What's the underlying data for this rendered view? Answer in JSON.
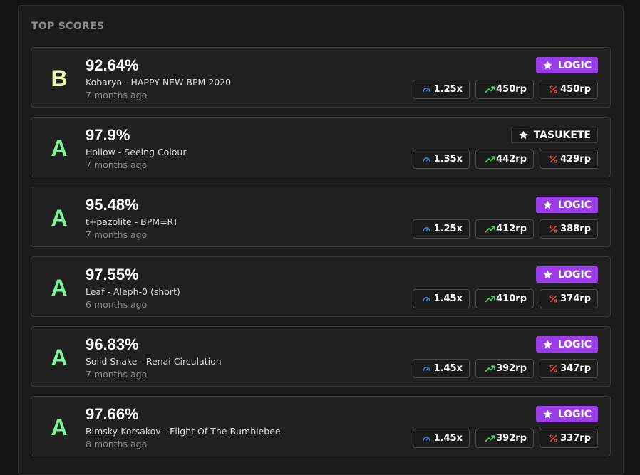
{
  "section_title": "TOP SCORES",
  "colors": {
    "grade_A": "#7ff29d",
    "grade_B": "#ecf9ad",
    "logic_badge": "#9b3ee8",
    "speed_icon": "#4e8ad8",
    "rp_icon": "#3fcf6a",
    "pct_icon": "#e04848"
  },
  "scores": [
    {
      "grade": "B",
      "accuracy": "92.64%",
      "song": "Kobaryo - HAPPY NEW BPM 2020",
      "ago": "7 months ago",
      "mod": "LOGIC",
      "mod_style": "logic",
      "speed": "1.25x",
      "rp": "450rp",
      "weighted": "450rp"
    },
    {
      "grade": "A",
      "accuracy": "97.9%",
      "song": "Hollow - Seeing Colour",
      "ago": "7 months ago",
      "mod": "TASUKETE",
      "mod_style": "tasukete",
      "speed": "1.35x",
      "rp": "442rp",
      "weighted": "429rp"
    },
    {
      "grade": "A",
      "accuracy": "95.48%",
      "song": "t+pazolite - BPM=RT",
      "ago": "7 months ago",
      "mod": "LOGIC",
      "mod_style": "logic",
      "speed": "1.25x",
      "rp": "412rp",
      "weighted": "388rp"
    },
    {
      "grade": "A",
      "accuracy": "97.55%",
      "song": "Leaf - Aleph-0 (short)",
      "ago": "6 months ago",
      "mod": "LOGIC",
      "mod_style": "logic",
      "speed": "1.45x",
      "rp": "410rp",
      "weighted": "374rp"
    },
    {
      "grade": "A",
      "accuracy": "96.83%",
      "song": "Solid Snake - Renai Circulation",
      "ago": "7 months ago",
      "mod": "LOGIC",
      "mod_style": "logic",
      "speed": "1.45x",
      "rp": "392rp",
      "weighted": "347rp"
    },
    {
      "grade": "A",
      "accuracy": "97.66%",
      "song": "Rimsky-Korsakov - Flight Of The Bumblebee",
      "ago": "8 months ago",
      "mod": "LOGIC",
      "mod_style": "logic",
      "speed": "1.45x",
      "rp": "392rp",
      "weighted": "337rp"
    }
  ]
}
